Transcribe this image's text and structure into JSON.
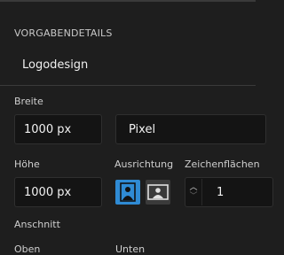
{
  "section": {
    "title": "VORGABENDETAILS",
    "preset_name": "Logodesign"
  },
  "width": {
    "label": "Breite",
    "value": "1000 px"
  },
  "unit": {
    "value": "Pixel"
  },
  "height": {
    "label": "Höhe",
    "value": "1000 px"
  },
  "orientation": {
    "label": "Ausrichtung",
    "options": [
      "portrait",
      "landscape"
    ],
    "selected": "portrait",
    "active_color": "#2f8bd4"
  },
  "artboards": {
    "label": "Zeichenflächen",
    "value": "1"
  },
  "bleed": {
    "label": "Anschnitt",
    "top_label": "Oben",
    "bottom_label": "Unten"
  }
}
